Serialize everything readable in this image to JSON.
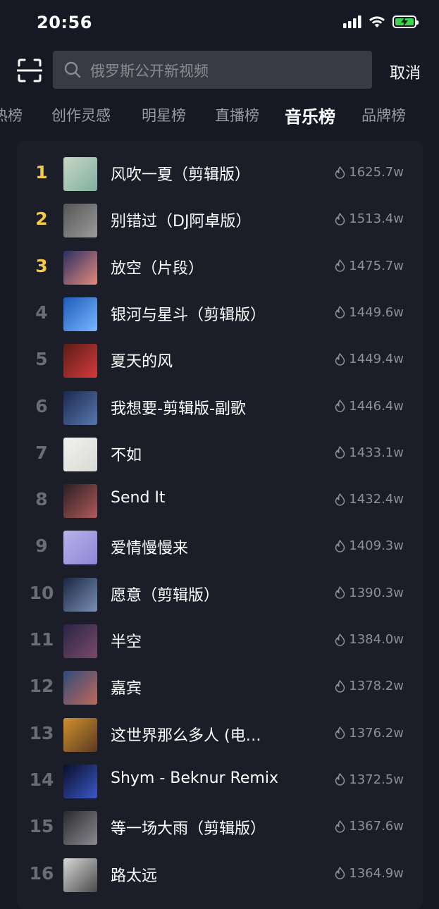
{
  "status_bar": {
    "time": "20:56"
  },
  "search": {
    "placeholder": "俄罗斯公开新视频",
    "cancel_label": "取消"
  },
  "tabs": [
    {
      "label": "热榜",
      "active": false
    },
    {
      "label": "创作灵感",
      "active": false
    },
    {
      "label": "明星榜",
      "active": false
    },
    {
      "label": "直播榜",
      "active": false
    },
    {
      "label": "音乐榜",
      "active": true
    },
    {
      "label": "品牌榜",
      "active": false
    }
  ],
  "colors": {
    "top_rank": "#f6c945",
    "rank": "#6c6d73",
    "background": "#161823",
    "card": "#1b1d28",
    "accent_battery": "#3dd54b"
  },
  "songs": [
    {
      "rank": "1",
      "title": "风吹一夏（剪辑版）",
      "heat": "1625.7w",
      "cover": [
        "#c9d6c4",
        "#7fb0a0"
      ]
    },
    {
      "rank": "2",
      "title": "别错过（DJ阿卓版）",
      "heat": "1513.4w",
      "cover": [
        "#555",
        "#9c9c9c"
      ]
    },
    {
      "rank": "3",
      "title": "放空（片段）",
      "heat": "1475.7w",
      "cover": [
        "#2b2f63",
        "#e58a7b"
      ]
    },
    {
      "rank": "4",
      "title": "银河与星斗（剪辑版）",
      "heat": "1449.6w",
      "cover": [
        "#1e5bb8",
        "#79b7ff"
      ]
    },
    {
      "rank": "5",
      "title": "夏天的风",
      "heat": "1449.4w",
      "cover": [
        "#5a1d18",
        "#d6393a"
      ]
    },
    {
      "rank": "6",
      "title": "我想要-剪辑版-副歌",
      "heat": "1446.4w",
      "cover": [
        "#1b2a4e",
        "#5876b0"
      ]
    },
    {
      "rank": "7",
      "title": "不如",
      "heat": "1433.1w",
      "cover": [
        "#f2f2f0",
        "#d8d8d4"
      ]
    },
    {
      "rank": "8",
      "title": "Send It",
      "heat": "1432.4w",
      "cover": [
        "#2a1f22",
        "#b05a5a"
      ]
    },
    {
      "rank": "9",
      "title": "爱情慢慢来",
      "heat": "1409.3w",
      "cover": [
        "#b9b2e9",
        "#8e86d6"
      ]
    },
    {
      "rank": "10",
      "title": "愿意（剪辑版）",
      "heat": "1390.3w",
      "cover": [
        "#1a2640",
        "#7a8fb6"
      ]
    },
    {
      "rank": "11",
      "title": "半空",
      "heat": "1384.0w",
      "cover": [
        "#2a2445",
        "#7a4a6a"
      ]
    },
    {
      "rank": "12",
      "title": "嘉宾",
      "heat": "1378.2w",
      "cover": [
        "#304a7a",
        "#c06a5a"
      ]
    },
    {
      "rank": "13",
      "title": "这世界那么多人 (电…",
      "heat": "1376.2w",
      "cover": [
        "#d09030",
        "#5a3a20"
      ]
    },
    {
      "rank": "14",
      "title": "Shym - Beknur Remix",
      "heat": "1372.5w",
      "cover": [
        "#0a0f2a",
        "#3a58c8"
      ]
    },
    {
      "rank": "15",
      "title": "等一场大雨（剪辑版）",
      "heat": "1367.6w",
      "cover": [
        "#2a2a2e",
        "#8a8a90"
      ]
    },
    {
      "rank": "16",
      "title": "路太远",
      "heat": "1364.9w",
      "cover": [
        "#d8d8d8",
        "#4a4a4a"
      ]
    }
  ]
}
